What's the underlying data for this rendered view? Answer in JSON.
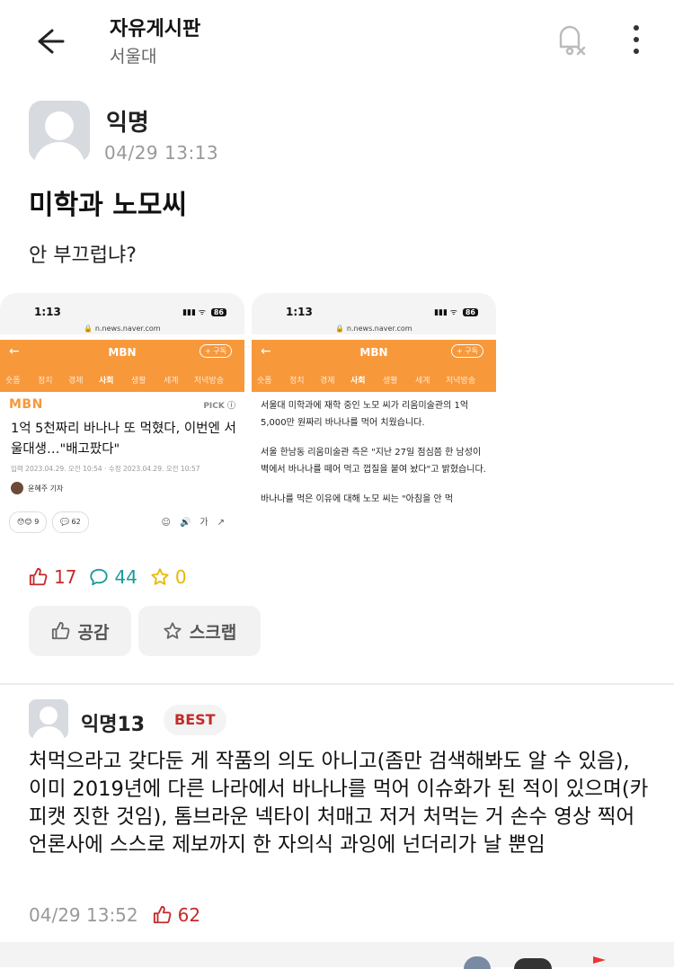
{
  "header": {
    "title": "자유게시판",
    "subtitle": "서울대"
  },
  "post": {
    "author": "익명",
    "time": "04/29 13:13",
    "title": "미학과 노모씨",
    "body": "안 부끄럽냐?"
  },
  "screenshot1": {
    "clock": "1:13",
    "battery": "86",
    "url": "n.news.naver.com",
    "logo": "MBN",
    "subscribe": "+ 구독",
    "tabs": [
      "숏폼",
      "정치",
      "경제",
      "사회",
      "생활",
      "세계",
      "저녁방송"
    ],
    "active_tab": "사회",
    "press": "MBN",
    "pick": "PICK ⓘ",
    "headline": "1억 5천짜리 바나나 또 먹혔다, 이번엔 서울대생…\"배고팠다\"",
    "meta": "입력 2023.04.29. 오전 10:54 · 수정 2023.04.29. 오전 10:57",
    "reporter": "윤혜주 기자",
    "reactions": "😯😊 9",
    "comments": "62"
  },
  "screenshot2": {
    "clock": "1:13",
    "battery": "86",
    "url": "n.news.naver.com",
    "logo": "MBN",
    "subscribe": "+ 구독",
    "tabs": [
      "숏폼",
      "정치",
      "경제",
      "사회",
      "생활",
      "세계",
      "저녁방송"
    ],
    "active_tab": "사회",
    "p1": "서울대 미학과에 재학 중인 노모 씨가 리움미술관의 1억 5,000만 원짜리 바나나를 먹어 치웠습니다.",
    "p2": "서울 한남동 리움미술관 측은 \"지난 27일 점심쯤 한 남성이 벽에서 바나나를 떼어 먹고 껍질을 붙여 놨다\"고 밝혔습니다.",
    "p3": "바나나를 먹은 이유에 대해 노모 씨는 \"아침을 안 먹"
  },
  "stats": {
    "likes": "17",
    "comments": "44",
    "scraps": "0"
  },
  "actions": {
    "like_label": "공감",
    "scrap_label": "스크랩"
  },
  "comment": {
    "author": "익명13",
    "badge": "BEST",
    "text": "처먹으라고 갖다둔 게 작품의 의도 아니고(좀만 검색해봐도 알 수 있음), 이미 2019년에 다른 나라에서 바나나를 먹어 이슈화가 된 적이 있으며(카피캣 짓한 것임), 톰브라운 넥타이 처매고 저거 처먹는 거 손수 영상 찍어 언론사에 스스로 제보까지 한 자의식 과잉에 넌더리가 날 뿐임",
    "time": "04/29 13:52",
    "likes": "62"
  },
  "colors": {
    "like_red": "#c62a2a",
    "comment_teal": "#1a9a9a",
    "scrap_yellow": "#e6b800",
    "news_orange": "#f7983b"
  }
}
